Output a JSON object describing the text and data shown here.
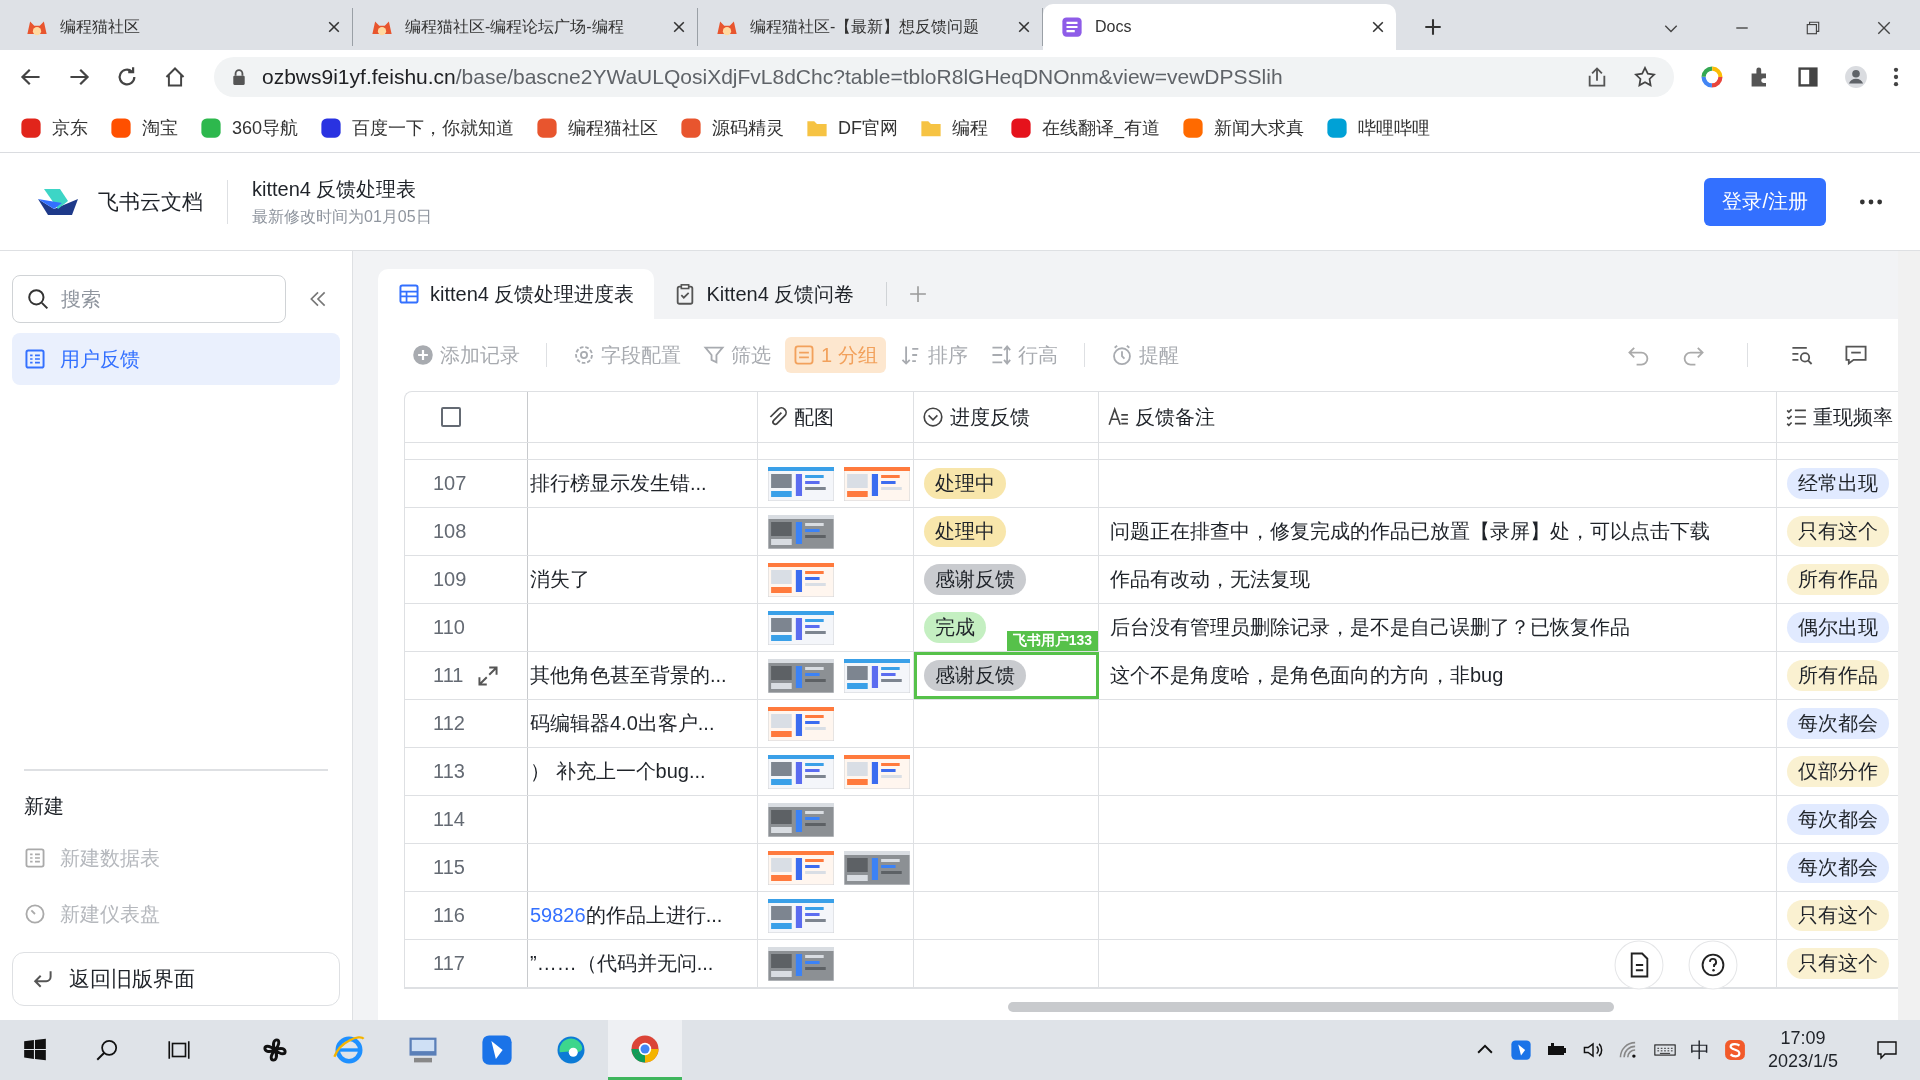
{
  "browser": {
    "tabs": [
      {
        "title": "编程猫社区",
        "selected": false
      },
      {
        "title": "编程猫社区-编程论坛广场-编程",
        "selected": false
      },
      {
        "title": "编程猫社区-【最新】想反馈问题",
        "selected": false
      },
      {
        "title": "Docs",
        "selected": true
      }
    ],
    "url_host": "ozbws9i1yf.feishu.cn",
    "url_path": "/base/bascne2YWaULQosiXdjFvL8dChc?table=tbloR8lGHeqDNOnm&view=vewDPSSlih",
    "bookmarks": [
      {
        "label": "京东",
        "kind": "jd"
      },
      {
        "label": "淘宝",
        "kind": "taobao"
      },
      {
        "label": "360导航",
        "kind": "nav360"
      },
      {
        "label": "百度一下，你就知道",
        "kind": "baidu"
      },
      {
        "label": "编程猫社区",
        "kind": "cat"
      },
      {
        "label": "源码精灵",
        "kind": "cat"
      },
      {
        "label": "DF官网",
        "kind": "folder"
      },
      {
        "label": "编程",
        "kind": "folder"
      },
      {
        "label": "在线翻译_有道",
        "kind": "youdao"
      },
      {
        "label": "新闻大求真",
        "kind": "news"
      },
      {
        "label": "哔哩哔哩",
        "kind": "bili"
      }
    ]
  },
  "header": {
    "brand": "飞书云文档",
    "title": "kitten4 反馈处理表",
    "subtitle": "最新修改时间为01月05日",
    "login_button": "登录/注册"
  },
  "sidebar": {
    "search": {
      "placeholder": "搜索"
    },
    "items": [
      {
        "label": "用户反馈",
        "selected": true
      }
    ],
    "new_heading": "新建",
    "new_items": [
      {
        "label": "新建数据表",
        "kind": "table"
      },
      {
        "label": "新建仪表盘",
        "kind": "dashboard"
      }
    ],
    "back_button": "返回旧版界面"
  },
  "view_tabs": [
    {
      "label": "kitten4 反馈处理进度表",
      "kind": "table",
      "selected": true
    },
    {
      "label": "Kitten4 反馈问卷",
      "kind": "form",
      "selected": false
    }
  ],
  "toolbar": [
    {
      "label": "添加记录",
      "kind": "add",
      "selected": false
    },
    {
      "label": "字段配置",
      "kind": "fields",
      "selected": false
    },
    {
      "label": "筛选",
      "kind": "filter",
      "selected": false
    },
    {
      "label": "1 分组",
      "kind": "group",
      "selected": true
    },
    {
      "label": "排序",
      "kind": "sort",
      "selected": false
    },
    {
      "label": "行高",
      "kind": "height",
      "selected": false
    },
    {
      "label": "提醒",
      "kind": "remind",
      "selected": false
    }
  ],
  "table": {
    "select_all": {
      "checked": false
    },
    "columns": [
      {
        "label": "配图",
        "kind": "attachment"
      },
      {
        "label": "进度反馈",
        "kind": "single_select"
      },
      {
        "label": "反馈备注",
        "kind": "text"
      },
      {
        "label": "重现频率",
        "kind": "multi_select"
      }
    ],
    "rows": [
      {
        "number": "107",
        "title": "排行榜显示发生错...",
        "status": {
          "label": "处理中",
          "color": "#f8e6ab"
        },
        "frequency": {
          "label": "经常出现",
          "color": "#e1eaff"
        },
        "selected": false,
        "hovered": false
      },
      {
        "number": "108",
        "status": {
          "label": "处理中",
          "color": "#f8e6ab"
        },
        "remark": "问题正在排查中，修复完成的作品已放置【录屏】处，可以点击下载",
        "frequency": {
          "label": "只有这个",
          "color": "#faf1d1"
        },
        "selected": false,
        "hovered": false
      },
      {
        "number": "109",
        "title": "消失了",
        "status": {
          "label": "感谢反馈",
          "color": "#c9cbcf"
        },
        "remark": "作品有改动，无法复现",
        "frequency": {
          "label": "所有作品",
          "color": "#faf1d1"
        },
        "selected": false,
        "hovered": false
      },
      {
        "number": "110",
        "status": {
          "label": "完成",
          "color": "#c4efc1"
        },
        "remark": "后台没有管理员删除记录，是不是自己误删了？已恢复作品",
        "frequency": {
          "label": "偶尔出现",
          "color": "#e1eaff"
        },
        "selected": false,
        "hovered": false
      },
      {
        "number": "111",
        "title": "其他角色甚至背景的...",
        "status": {
          "label": "感谢反馈",
          "color": "#c9cbcf"
        },
        "remark": "这个不是角度哈，是角色面向的方向，非bug",
        "frequency": {
          "label": "所有作品",
          "color": "#faf1d1"
        },
        "selected": true,
        "hovered": true,
        "collaborator": "飞书用户133"
      },
      {
        "number": "112",
        "title": "码编辑器4.0出客户...",
        "frequency": {
          "label": "每次都会",
          "color": "#e1eaff"
        },
        "selected": false,
        "hovered": false
      },
      {
        "number": "113",
        "title": "） 补充上一个bug...",
        "frequency": {
          "label": "仅部分作",
          "color": "#faf1d1"
        },
        "selected": false,
        "hovered": false
      },
      {
        "number": "114",
        "frequency": {
          "label": "每次都会",
          "color": "#e1eaff"
        },
        "selected": false,
        "hovered": false
      },
      {
        "number": "115",
        "frequency": {
          "label": "每次都会",
          "color": "#e1eaff"
        },
        "selected": false,
        "hovered": false
      },
      {
        "number": "116",
        "link": "59826",
        "title": "的作品上进行...",
        "frequency": {
          "label": "只有这个",
          "color": "#faf1d1"
        },
        "selected": false,
        "hovered": false
      },
      {
        "number": "117",
        "title": "”……（代码并无问...",
        "frequency": {
          "label": "只有这个",
          "color": "#faf1d1"
        },
        "selected": false,
        "hovered": false
      }
    ]
  },
  "taskbar": {
    "apps": [
      {
        "kind": "fan",
        "selected": false
      },
      {
        "kind": "ie",
        "selected": false
      },
      {
        "kind": "pc",
        "selected": false
      },
      {
        "kind": "feishu",
        "selected": false
      },
      {
        "kind": "edge",
        "selected": false
      },
      {
        "kind": "chrome",
        "selected": true
      }
    ],
    "ime": "中",
    "time": "17:09",
    "date": "2023/1/5"
  }
}
